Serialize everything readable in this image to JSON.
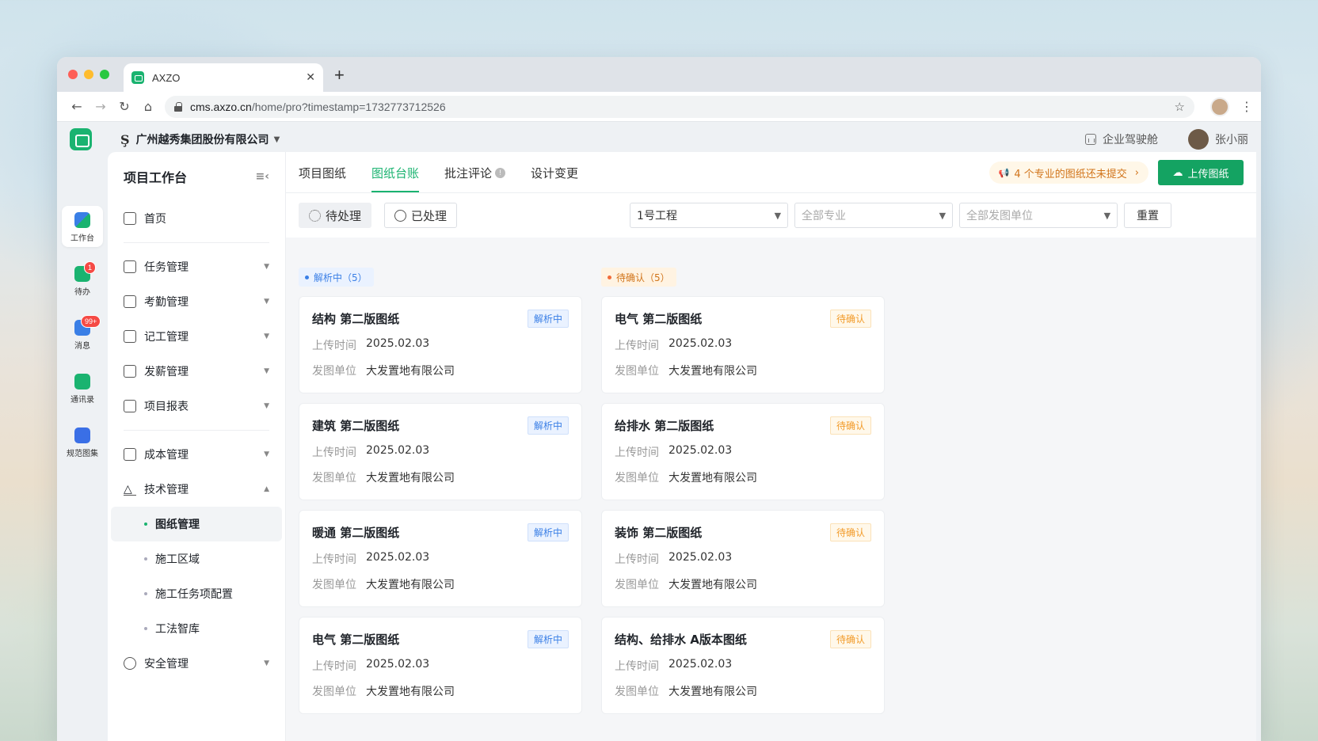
{
  "browser": {
    "tab_title": "AXZO",
    "url_host": "cms.axzo.cn",
    "url_path": "/home/pro?timestamp=1732773712526"
  },
  "header": {
    "company": "广州越秀集团股份有限公司",
    "cockpit": "企业驾驶舱",
    "user": "张小丽"
  },
  "rail": [
    {
      "label": "工作台"
    },
    {
      "label": "待办",
      "badge": "1"
    },
    {
      "label": "消息",
      "badge": "99+"
    },
    {
      "label": "通讯录"
    },
    {
      "label": "规范图集"
    }
  ],
  "sidebar": {
    "title": "项目工作台",
    "home": "首页",
    "items": [
      "任务管理",
      "考勤管理",
      "记工管理",
      "发薪管理",
      "项目报表",
      "成本管理",
      "技术管理"
    ],
    "sub_items": [
      "图纸管理",
      "施工区域",
      "施工任务项配置",
      "工法智库"
    ],
    "safety": "安全管理"
  },
  "tabs": [
    "项目图纸",
    "图纸台账",
    "批注评论",
    "设计变更"
  ],
  "notice": "4 个专业的图纸还未提交",
  "upload_label": "上传图纸",
  "filters": {
    "pending": "待处理",
    "processed": "已处理",
    "project": "1号工程",
    "discipline_placeholder": "全部专业",
    "unit_placeholder": "全部发图单位",
    "reset": "重置"
  },
  "columns": [
    {
      "header": "解析中（5）",
      "status": "解析中",
      "cards": [
        {
          "title": "结构 第二版图纸",
          "upload_label": "上传时间",
          "upload_time": "2025.02.03",
          "unit_label": "发图单位",
          "unit": "大发置地有限公司"
        },
        {
          "title": "建筑 第二版图纸",
          "upload_label": "上传时间",
          "upload_time": "2025.02.03",
          "unit_label": "发图单位",
          "unit": "大发置地有限公司"
        },
        {
          "title": "暖通 第二版图纸",
          "upload_label": "上传时间",
          "upload_time": "2025.02.03",
          "unit_label": "发图单位",
          "unit": "大发置地有限公司"
        },
        {
          "title": "电气 第二版图纸",
          "upload_label": "上传时间",
          "upload_time": "2025.02.03",
          "unit_label": "发图单位",
          "unit": "大发置地有限公司"
        }
      ]
    },
    {
      "header": "待确认（5）",
      "status": "待确认",
      "cards": [
        {
          "title": "电气 第二版图纸",
          "upload_label": "上传时间",
          "upload_time": "2025.02.03",
          "unit_label": "发图单位",
          "unit": "大发置地有限公司"
        },
        {
          "title": "给排水 第二版图纸",
          "upload_label": "上传时间",
          "upload_time": "2025.02.03",
          "unit_label": "发图单位",
          "unit": "大发置地有限公司"
        },
        {
          "title": "装饰 第二版图纸",
          "upload_label": "上传时间",
          "upload_time": "2025.02.03",
          "unit_label": "发图单位",
          "unit": "大发置地有限公司"
        },
        {
          "title": "结构、给排水 A版本图纸",
          "upload_label": "上传时间",
          "upload_time": "2025.02.03",
          "unit_label": "发图单位",
          "unit": "大发置地有限公司"
        }
      ]
    }
  ],
  "colors": {
    "brand": "#1ab370",
    "parsing": "#3a7fe6",
    "pending": "#f29b2a"
  }
}
